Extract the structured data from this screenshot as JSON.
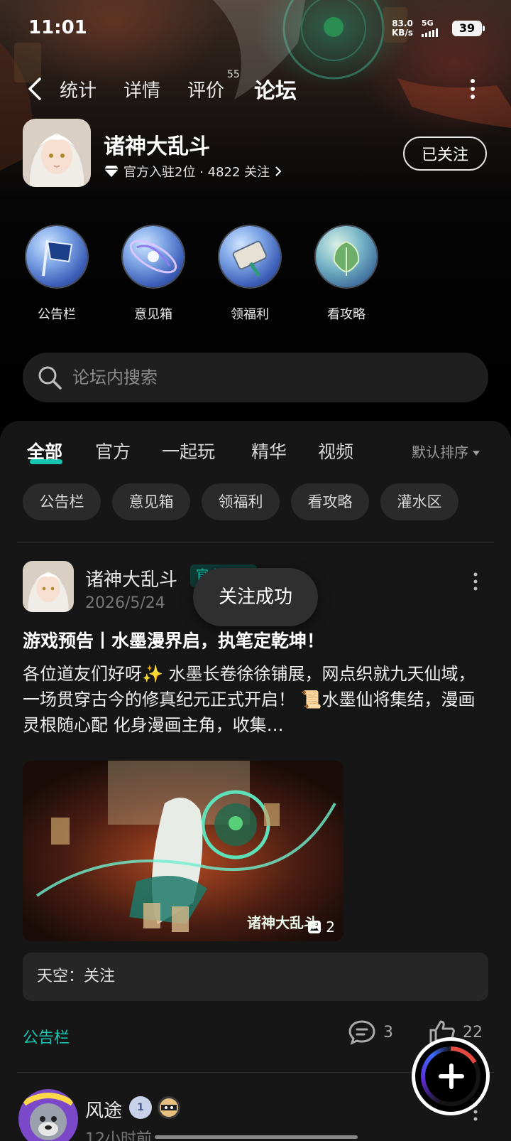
{
  "status_bar": {
    "time": "11:01",
    "net_speed_value": "83.0",
    "net_speed_unit": "KB/s",
    "network": "5G",
    "battery": "39"
  },
  "top_nav": {
    "tabs": [
      {
        "label": "统计"
      },
      {
        "label": "详情"
      },
      {
        "label": "评价"
      },
      {
        "label": "论坛"
      }
    ],
    "review_count": "55",
    "active_tab": "论坛"
  },
  "game": {
    "title": "诸神大乱斗",
    "meta": "官方入驻2位 · 4822 关注",
    "follow_label": "已关注"
  },
  "quick_entries": [
    {
      "label": "公告栏",
      "icon": "flag-icon"
    },
    {
      "label": "意见箱",
      "icon": "galaxy-icon"
    },
    {
      "label": "领福利",
      "icon": "scroll-icon"
    },
    {
      "label": "看攻略",
      "icon": "leaf-icon"
    }
  ],
  "search": {
    "placeholder": "论坛内搜索"
  },
  "content_tabs": [
    {
      "label": "全部"
    },
    {
      "label": "官方"
    },
    {
      "label": "一起玩"
    },
    {
      "label": "精华"
    },
    {
      "label": "视频"
    }
  ],
  "sort_label": "默认排序",
  "chips": [
    {
      "label": "公告栏"
    },
    {
      "label": "意见箱"
    },
    {
      "label": "领福利"
    },
    {
      "label": "看攻略"
    },
    {
      "label": "灌水区"
    }
  ],
  "post": {
    "author": "诸神大乱斗",
    "tag": "官方",
    "date": "2026/5/24",
    "title": "游戏预告丨水墨漫界启，执笔定乾坤！",
    "body": "各位道友们好呀✨ 水墨长卷徐徐铺展，网点织就九天仙域，一场贯穿古今的修真纪元正式开启！ 📜水墨仙将集结，漫画灵根随心配 化身漫画主角，收集…",
    "image_count": "2",
    "image_caption": "诸神大乱斗",
    "comment": "天空：关注",
    "board": "公告栏",
    "comments": "3",
    "likes": "22"
  },
  "toast": "关注成功",
  "post2": {
    "author": "风途",
    "date": "12小时前",
    "level": "1"
  }
}
